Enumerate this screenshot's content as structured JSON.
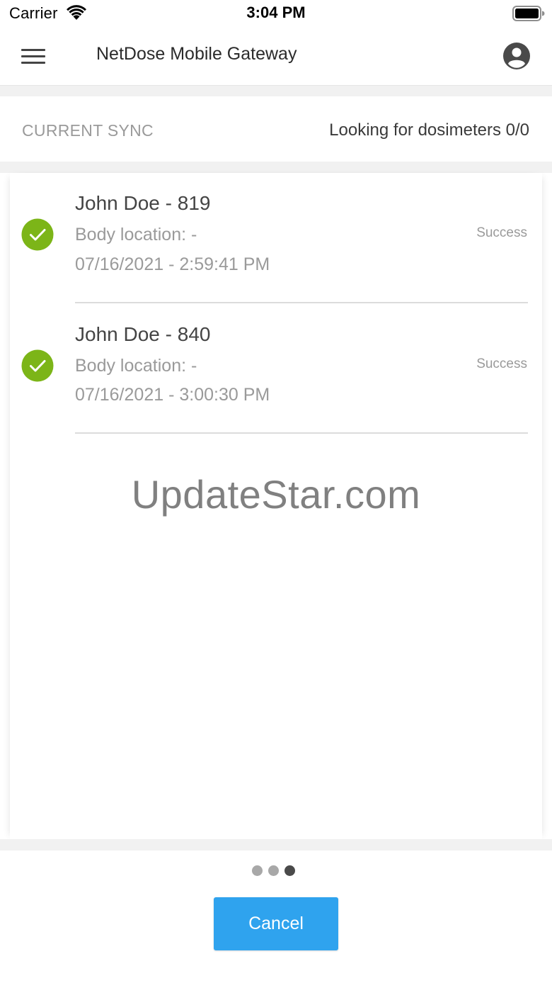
{
  "status_bar": {
    "carrier": "Carrier",
    "time": "3:04 PM",
    "wifi_icon": "wifi-icon",
    "battery_icon": "battery-icon"
  },
  "header": {
    "menu_icon": "hamburger-menu-icon",
    "title": "NetDose Mobile Gateway",
    "account_icon": "user-account-icon"
  },
  "sync": {
    "label": "CURRENT SYNC",
    "status": "Looking for dosimeters 0/0"
  },
  "devices": [
    {
      "name": "John Doe - 819",
      "location": "Body location: -",
      "timestamp": "07/16/2021 - 2:59:41 PM",
      "result": "Success",
      "status_icon": "check-circle-icon"
    },
    {
      "name": "John Doe - 840",
      "location": "Body location: -",
      "timestamp": "07/16/2021 - 3:00:30 PM",
      "result": "Success",
      "status_icon": "check-circle-icon"
    }
  ],
  "watermark": "UpdateStar.com",
  "footer": {
    "pager": {
      "count": 3,
      "active_index": 2
    },
    "cancel_label": "Cancel"
  },
  "colors": {
    "success_green": "#7cb518",
    "button_blue": "#2fa3ee",
    "muted_text": "#9a9a9a",
    "band_gray": "#f1f1f1"
  }
}
